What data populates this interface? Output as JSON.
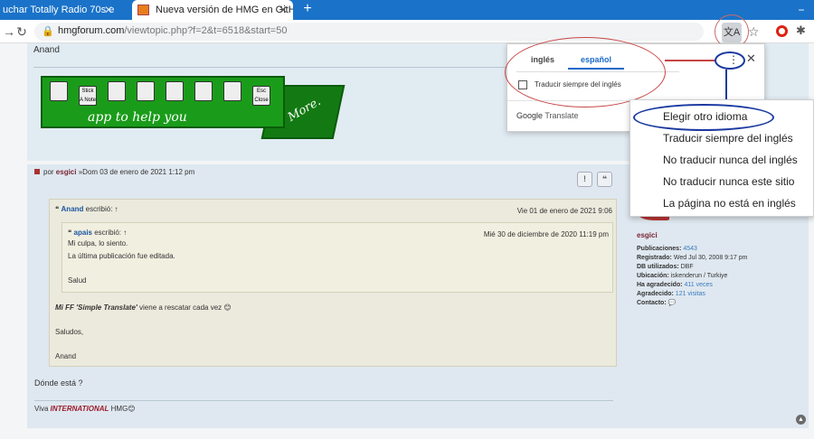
{
  "browser": {
    "tabs": [
      {
        "title": "uchar Totally Radio 70s e",
        "active": false
      },
      {
        "title": "Nueva versión de HMG en GitHu",
        "active": true
      }
    ],
    "new_tab": "+",
    "url_host": "hmgforum.com",
    "url_path": "/viewtopic.php?f=2&t=6518&start=50",
    "window_control": "−"
  },
  "post1": {
    "author": "Anand",
    "banner": {
      "icon_labels": [
        "",
        "Stick A Note",
        "",
        "",
        "",
        "",
        "",
        "Esc Close"
      ],
      "text": "app to help you",
      "more": "More."
    }
  },
  "post2": {
    "by": "por",
    "user": "esgici",
    "date": "»Dom 03 de enero de 2021 1:12 pm",
    "quote1": {
      "author": "Anand",
      "wrote": "escribió: ↑",
      "date": "Vie 01 de enero de 2021 9:06",
      "quote2": {
        "author": "apais",
        "wrote": "escribió: ↑",
        "date": "Mié 30 de diciembre de 2020 11:19 pm",
        "line1": "Mi culpa, lo siento.",
        "line2": "La última publicación fue editada.",
        "line3": "Salud"
      },
      "ff_bold": "Mi FF 'Simple Translate'",
      "ff_rest": " viene a rescatar cada vez",
      "saludos": "Saludos,",
      "sign": "Anand"
    },
    "question": "Dónde está ?",
    "viva": "Viva",
    "international": "INTERNATIONAL",
    "hmg": "HMG"
  },
  "profile": {
    "username": "esgici",
    "rows": [
      {
        "label": "Publicaciones:",
        "value": "4543"
      },
      {
        "label": "Registrado:",
        "value": "Wed Jul 30, 2008 9:17 pm"
      },
      {
        "label": "DB utilizados:",
        "value": "DBF"
      },
      {
        "label": "Ubicación:",
        "value": "iskenderun / Turkiye"
      },
      {
        "label": "Ha agradecido:",
        "value": "411 veces"
      },
      {
        "label": "Agradecido:",
        "value": "121 visitas"
      },
      {
        "label": "Contacto:",
        "value": ""
      }
    ]
  },
  "translate_popup": {
    "tab_source": "inglés",
    "tab_target": "español",
    "always_translate": "Traducir siempre del inglés",
    "brand_google": "Google",
    "brand_translate": "Translate"
  },
  "context_menu": [
    "Elegir otro idioma",
    "Traducir siempre del inglés",
    "No traducir nunca del inglés",
    "No traducir nunca este sitio",
    "La página no está en inglés"
  ]
}
